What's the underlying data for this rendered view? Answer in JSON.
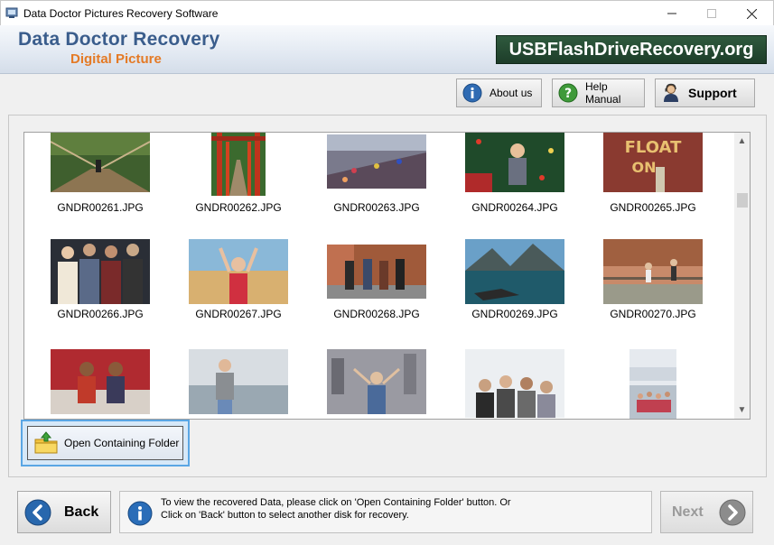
{
  "window": {
    "title": "Data Doctor Pictures Recovery Software",
    "minimize_glyph": "—",
    "maximize_glyph": "☐",
    "close_glyph": "✕"
  },
  "banner": {
    "brand": "Data Doctor Recovery",
    "subtitle": "Digital Picture",
    "site": "USBFlashDriveRecovery.org"
  },
  "toolbar": {
    "about_label": "About us",
    "help_label": "Help Manual",
    "support_label": "Support"
  },
  "gallery": {
    "items": [
      {
        "name": "GNDR00261.JPG",
        "scene": "rope-bridge"
      },
      {
        "name": "GNDR00262.JPG",
        "scene": "torii-path"
      },
      {
        "name": "GNDR00263.JPG",
        "scene": "crowd-bridge"
      },
      {
        "name": "GNDR00264.JPG",
        "scene": "christmas-child"
      },
      {
        "name": "GNDR00265.JPG",
        "scene": "float-balloons"
      },
      {
        "name": "GNDR00266.JPG",
        "scene": "four-friends"
      },
      {
        "name": "GNDR00267.JPG",
        "scene": "festival-girl"
      },
      {
        "name": "GNDR00268.JPG",
        "scene": "street-walkers"
      },
      {
        "name": "GNDR00269.JPG",
        "scene": "mountain-lake"
      },
      {
        "name": "GNDR00270.JPG",
        "scene": "park-jump"
      },
      {
        "name": "",
        "scene": "two-kids"
      },
      {
        "name": "",
        "scene": "woman-sea"
      },
      {
        "name": "",
        "scene": "city-rooftop"
      },
      {
        "name": "",
        "scene": "group-selfie"
      },
      {
        "name": "",
        "scene": "group-portrait"
      }
    ]
  },
  "open_folder_label": "Open Containing Folder",
  "footer": {
    "back_label": "Back",
    "info_line1": "To view the recovered Data, please click on 'Open Containing Folder' button. Or",
    "info_line2": "Click on 'Back' button to select another disk for recovery.",
    "next_label": "Next"
  },
  "colors": {
    "brand_blue": "#3a5d8c",
    "brand_orange": "#e47a25",
    "site_green": "#2f5a3e",
    "selection_blue": "#5aa6e4"
  }
}
